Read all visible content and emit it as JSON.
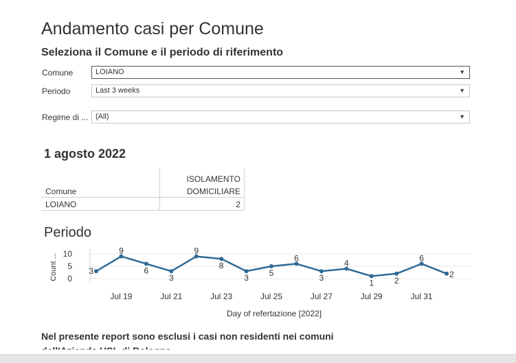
{
  "title": "Andamento casi per Comune",
  "subtitle": "Seleziona il Comune e il periodo di riferimento",
  "filters": [
    {
      "label": "Comune",
      "value": "LOIANO"
    },
    {
      "label": "Periodo",
      "value": "Last 3 weeks"
    },
    {
      "label": "Regime di ...",
      "value": "(All)"
    }
  ],
  "date_heading": "1 agosto 2022",
  "table": {
    "header_col1": "Comune",
    "header_col2_line1": "ISOLAMENTO",
    "header_col2_line2": "DOMICILIARE",
    "rows": [
      {
        "comune": "LOIANO",
        "value": "2"
      }
    ]
  },
  "section_heading": "Periodo",
  "footer_text": "Nel presente report sono esclusi i casi non residenti nei comuni",
  "footer_text_cut": "dell'Azienda USL di Bologna",
  "colors": {
    "line": "#2e6a96",
    "text": "#333333"
  },
  "chart_data": {
    "type": "line",
    "xlabel": "Day of refertazione [2022]",
    "ylabel": "Count ...",
    "ylim": [
      0,
      10
    ],
    "yticks": [
      0,
      5,
      10
    ],
    "x": [
      "2022-07-18",
      "2022-07-19",
      "2022-07-20",
      "2022-07-21",
      "2022-07-22",
      "2022-07-23",
      "2022-07-24",
      "2022-07-25",
      "2022-07-26",
      "2022-07-27",
      "2022-07-28",
      "2022-07-29",
      "2022-07-30",
      "2022-07-31",
      "2022-08-01"
    ],
    "xtick_labels": [
      "Jul 19",
      "Jul 21",
      "Jul 23",
      "Jul 25",
      "Jul 27",
      "Jul 29",
      "Jul 31"
    ],
    "xtick_dates": [
      "2022-07-19",
      "2022-07-21",
      "2022-07-23",
      "2022-07-25",
      "2022-07-27",
      "2022-07-29",
      "2022-07-31"
    ],
    "values": [
      3,
      9,
      6,
      3,
      9,
      8,
      3,
      5,
      6,
      3,
      4,
      1,
      2,
      6,
      2
    ],
    "labels": [
      "3",
      "9",
      "6",
      "3",
      "9",
      "8",
      "3",
      "5",
      "6",
      "3",
      "4",
      "1",
      "2",
      "6",
      "2"
    ]
  }
}
